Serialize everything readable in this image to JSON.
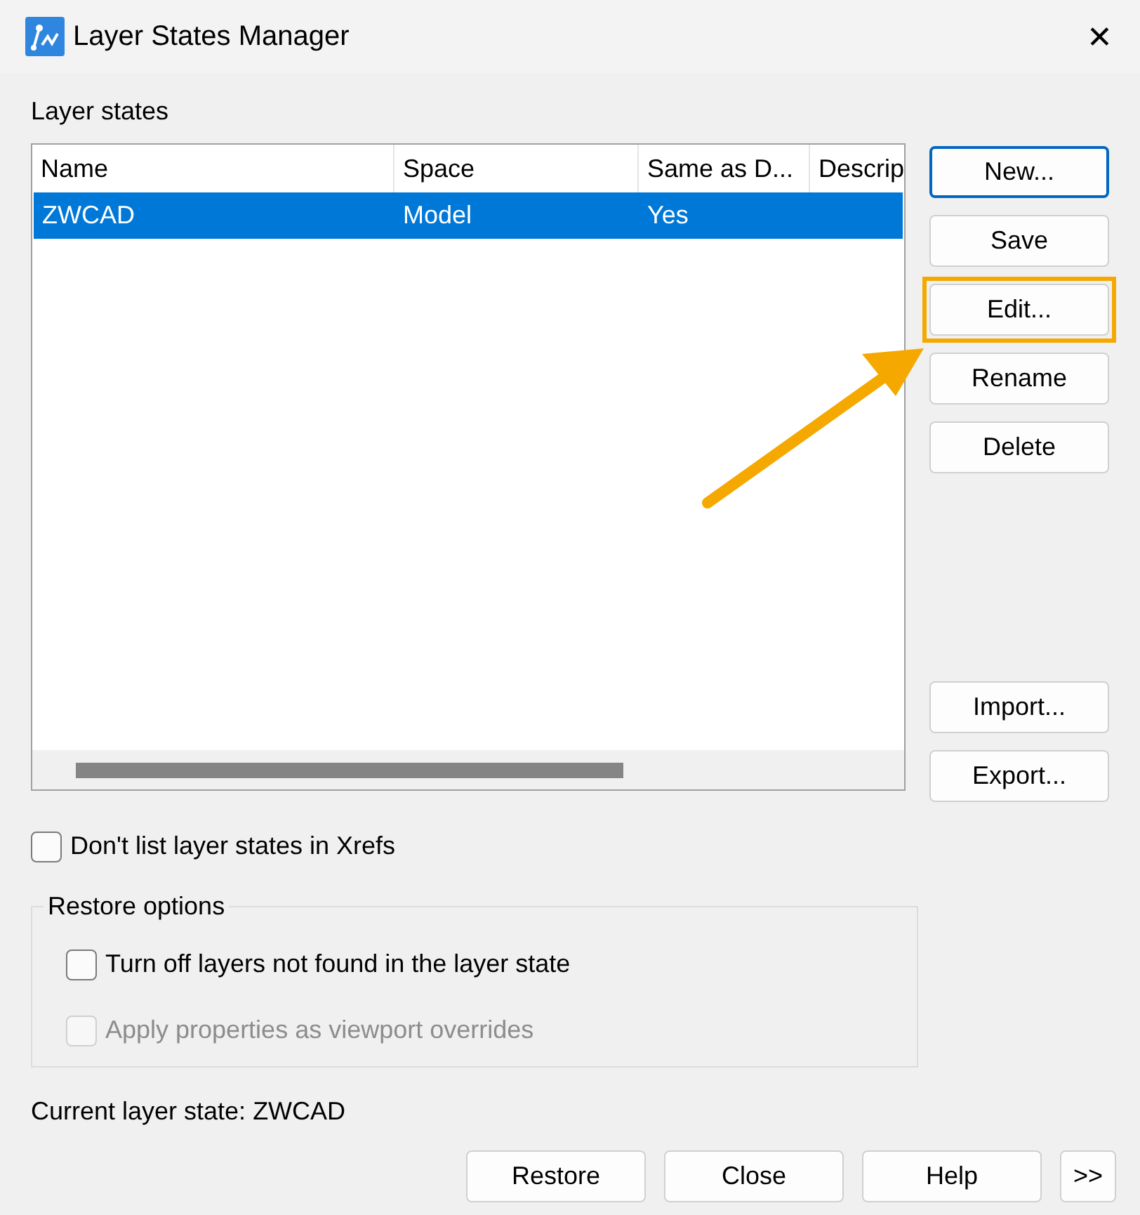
{
  "window": {
    "title": "Layer States Manager",
    "close": "✕"
  },
  "layer_states": {
    "label": "Layer states",
    "columns": [
      "Name",
      "Space",
      "Same as D...",
      "Descrip"
    ],
    "rows": [
      {
        "cells": [
          "ZWCAD",
          "Model",
          "Yes",
          ""
        ],
        "selected": true
      }
    ]
  },
  "side_buttons": [
    {
      "label": "New...",
      "default": true,
      "highlighted": false
    },
    {
      "label": "Save",
      "default": false,
      "highlighted": false
    },
    {
      "label": "Edit...",
      "default": false,
      "highlighted": true
    },
    {
      "label": "Rename",
      "default": false,
      "highlighted": false
    },
    {
      "label": "Delete",
      "default": false,
      "highlighted": false
    }
  ],
  "side_buttons_lower": [
    {
      "label": "Import...",
      "default": false,
      "highlighted": false
    },
    {
      "label": "Export...",
      "default": false,
      "highlighted": false
    }
  ],
  "xrefs_option": {
    "label": "Don't list layer states in Xrefs",
    "checked": false,
    "disabled": false
  },
  "restore_options": {
    "label": "Restore options",
    "options": [
      {
        "label": "Turn off layers not found in the layer state",
        "checked": false,
        "disabled": false
      },
      {
        "label": "Apply properties as viewport overrides",
        "checked": false,
        "disabled": true
      }
    ]
  },
  "current_state": "Current layer state: ZWCAD",
  "bottom_buttons": [
    "Restore",
    "Close",
    "Help",
    ">>"
  ],
  "annotation": {
    "kind": "arrow",
    "color": "#f5a900"
  }
}
